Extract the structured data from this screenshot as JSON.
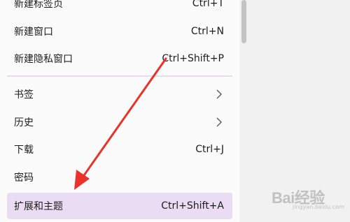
{
  "menu": {
    "items": [
      {
        "label": "新建标签页",
        "shortcut": "Ctrl+T"
      },
      {
        "label": "新建窗口",
        "shortcut": "Ctrl+N"
      },
      {
        "label": "新建隐私窗口",
        "shortcut": "Ctrl+Shift+P"
      },
      {
        "label": "书签",
        "shortcut": ""
      },
      {
        "label": "历史",
        "shortcut": ""
      },
      {
        "label": "下载",
        "shortcut": "Ctrl+J"
      },
      {
        "label": "密码",
        "shortcut": ""
      },
      {
        "label": "扩展和主题",
        "shortcut": "Ctrl+Shift+A"
      }
    ]
  },
  "colors": {
    "selected_bg": "#eaddf3",
    "arrow": "#e8322b"
  },
  "watermark": {
    "text": "Bai经验",
    "sub": "jingyan.baidu.com"
  }
}
